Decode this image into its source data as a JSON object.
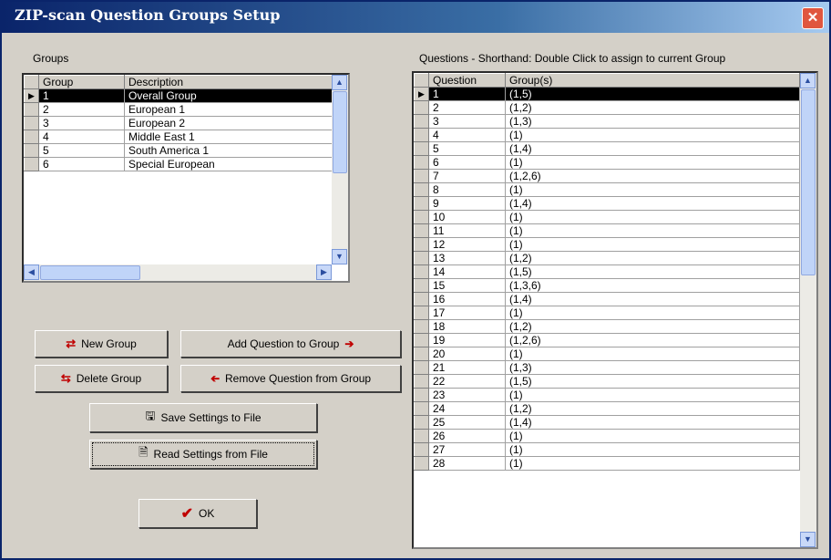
{
  "window": {
    "title": "ZIP-scan Question Groups Setup"
  },
  "groups": {
    "label": "Groups",
    "headers": [
      "Group",
      "Description"
    ],
    "rows": [
      {
        "group": "1",
        "description": "Overall Group",
        "selected": true
      },
      {
        "group": "2",
        "description": "European 1"
      },
      {
        "group": "3",
        "description": "European 2"
      },
      {
        "group": "4",
        "description": "Middle East 1"
      },
      {
        "group": "5",
        "description": "South America 1"
      },
      {
        "group": "6",
        "description": "Special European"
      }
    ]
  },
  "questions": {
    "label": "Questions  -  Shorthand: Double Click to assign to current Group",
    "headers": [
      "Question",
      "Group(s)"
    ],
    "rows": [
      {
        "q": "1",
        "g": "(1,5)",
        "selected": true
      },
      {
        "q": "2",
        "g": "(1,2)"
      },
      {
        "q": "3",
        "g": "(1,3)"
      },
      {
        "q": "4",
        "g": "(1)"
      },
      {
        "q": "5",
        "g": "(1,4)"
      },
      {
        "q": "6",
        "g": "(1)"
      },
      {
        "q": "7",
        "g": "(1,2,6)"
      },
      {
        "q": "8",
        "g": "(1)"
      },
      {
        "q": "9",
        "g": "(1,4)"
      },
      {
        "q": "10",
        "g": "(1)"
      },
      {
        "q": "11",
        "g": "(1)"
      },
      {
        "q": "12",
        "g": "(1)"
      },
      {
        "q": "13",
        "g": "(1,2)"
      },
      {
        "q": "14",
        "g": "(1,5)"
      },
      {
        "q": "15",
        "g": "(1,3,6)"
      },
      {
        "q": "16",
        "g": "(1,4)"
      },
      {
        "q": "17",
        "g": "(1)"
      },
      {
        "q": "18",
        "g": "(1,2)"
      },
      {
        "q": "19",
        "g": "(1,2,6)"
      },
      {
        "q": "20",
        "g": "(1)"
      },
      {
        "q": "21",
        "g": "(1,3)"
      },
      {
        "q": "22",
        "g": "(1,5)"
      },
      {
        "q": "23",
        "g": "(1)"
      },
      {
        "q": "24",
        "g": "(1,2)"
      },
      {
        "q": "25",
        "g": "(1,4)"
      },
      {
        "q": "26",
        "g": "(1)"
      },
      {
        "q": "27",
        "g": "(1)"
      },
      {
        "q": "28",
        "g": "(1)"
      }
    ]
  },
  "buttons": {
    "new_group": "New Group",
    "delete_group": "Delete Group",
    "add_question": "Add Question to Group",
    "remove_question": "Remove Question from Group",
    "save_settings": "Save Settings to File",
    "read_settings": "Read Settings from File",
    "ok": "OK"
  },
  "colors": {
    "title_bar": "#0a246a",
    "dialog_bg": "#d4d0c8",
    "selection": "#000000",
    "close_button": "#e0563f",
    "arrow": "#c00000"
  },
  "icons": [
    "close-icon",
    "new-group-icon",
    "delete-group-icon",
    "arrow-right-icon",
    "arrow-left-icon",
    "save-file-icon",
    "read-file-icon",
    "checkmark-icon",
    "row-pointer-icon"
  ]
}
